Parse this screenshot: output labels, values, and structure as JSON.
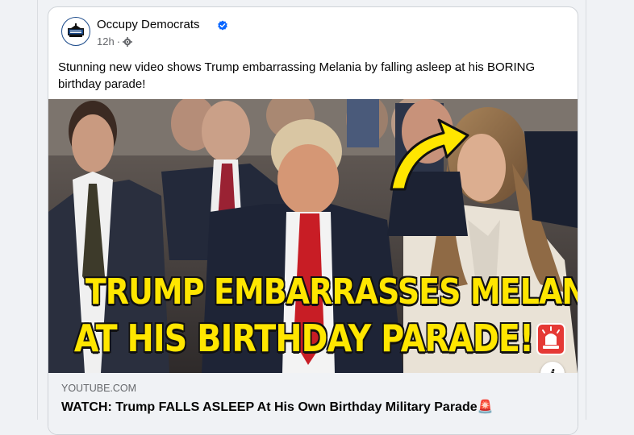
{
  "post": {
    "author": "Occupy Democrats",
    "timestamp": "12h",
    "verified": true,
    "caption": "Stunning new video shows Trump embarrassing Melania by falling asleep at his BORING birthday parade!",
    "privacy_icon": "settings-globe-icon"
  },
  "media": {
    "headline_line1": "TRUMP EMBARRASSES MELANIA",
    "headline_line2": "AT HIS BIRTHDAY PARADE!",
    "headline_color": "#ffe600",
    "info_label": "i"
  },
  "link": {
    "domain": "YOUTUBE.COM",
    "title": "WATCH: Trump FALLS ASLEEP At His Own Birthday Military Parade🚨"
  },
  "colors": {
    "verified_blue": "#0866ff",
    "card_border": "#cfd3d8",
    "link_bg": "#f0f2f5"
  }
}
